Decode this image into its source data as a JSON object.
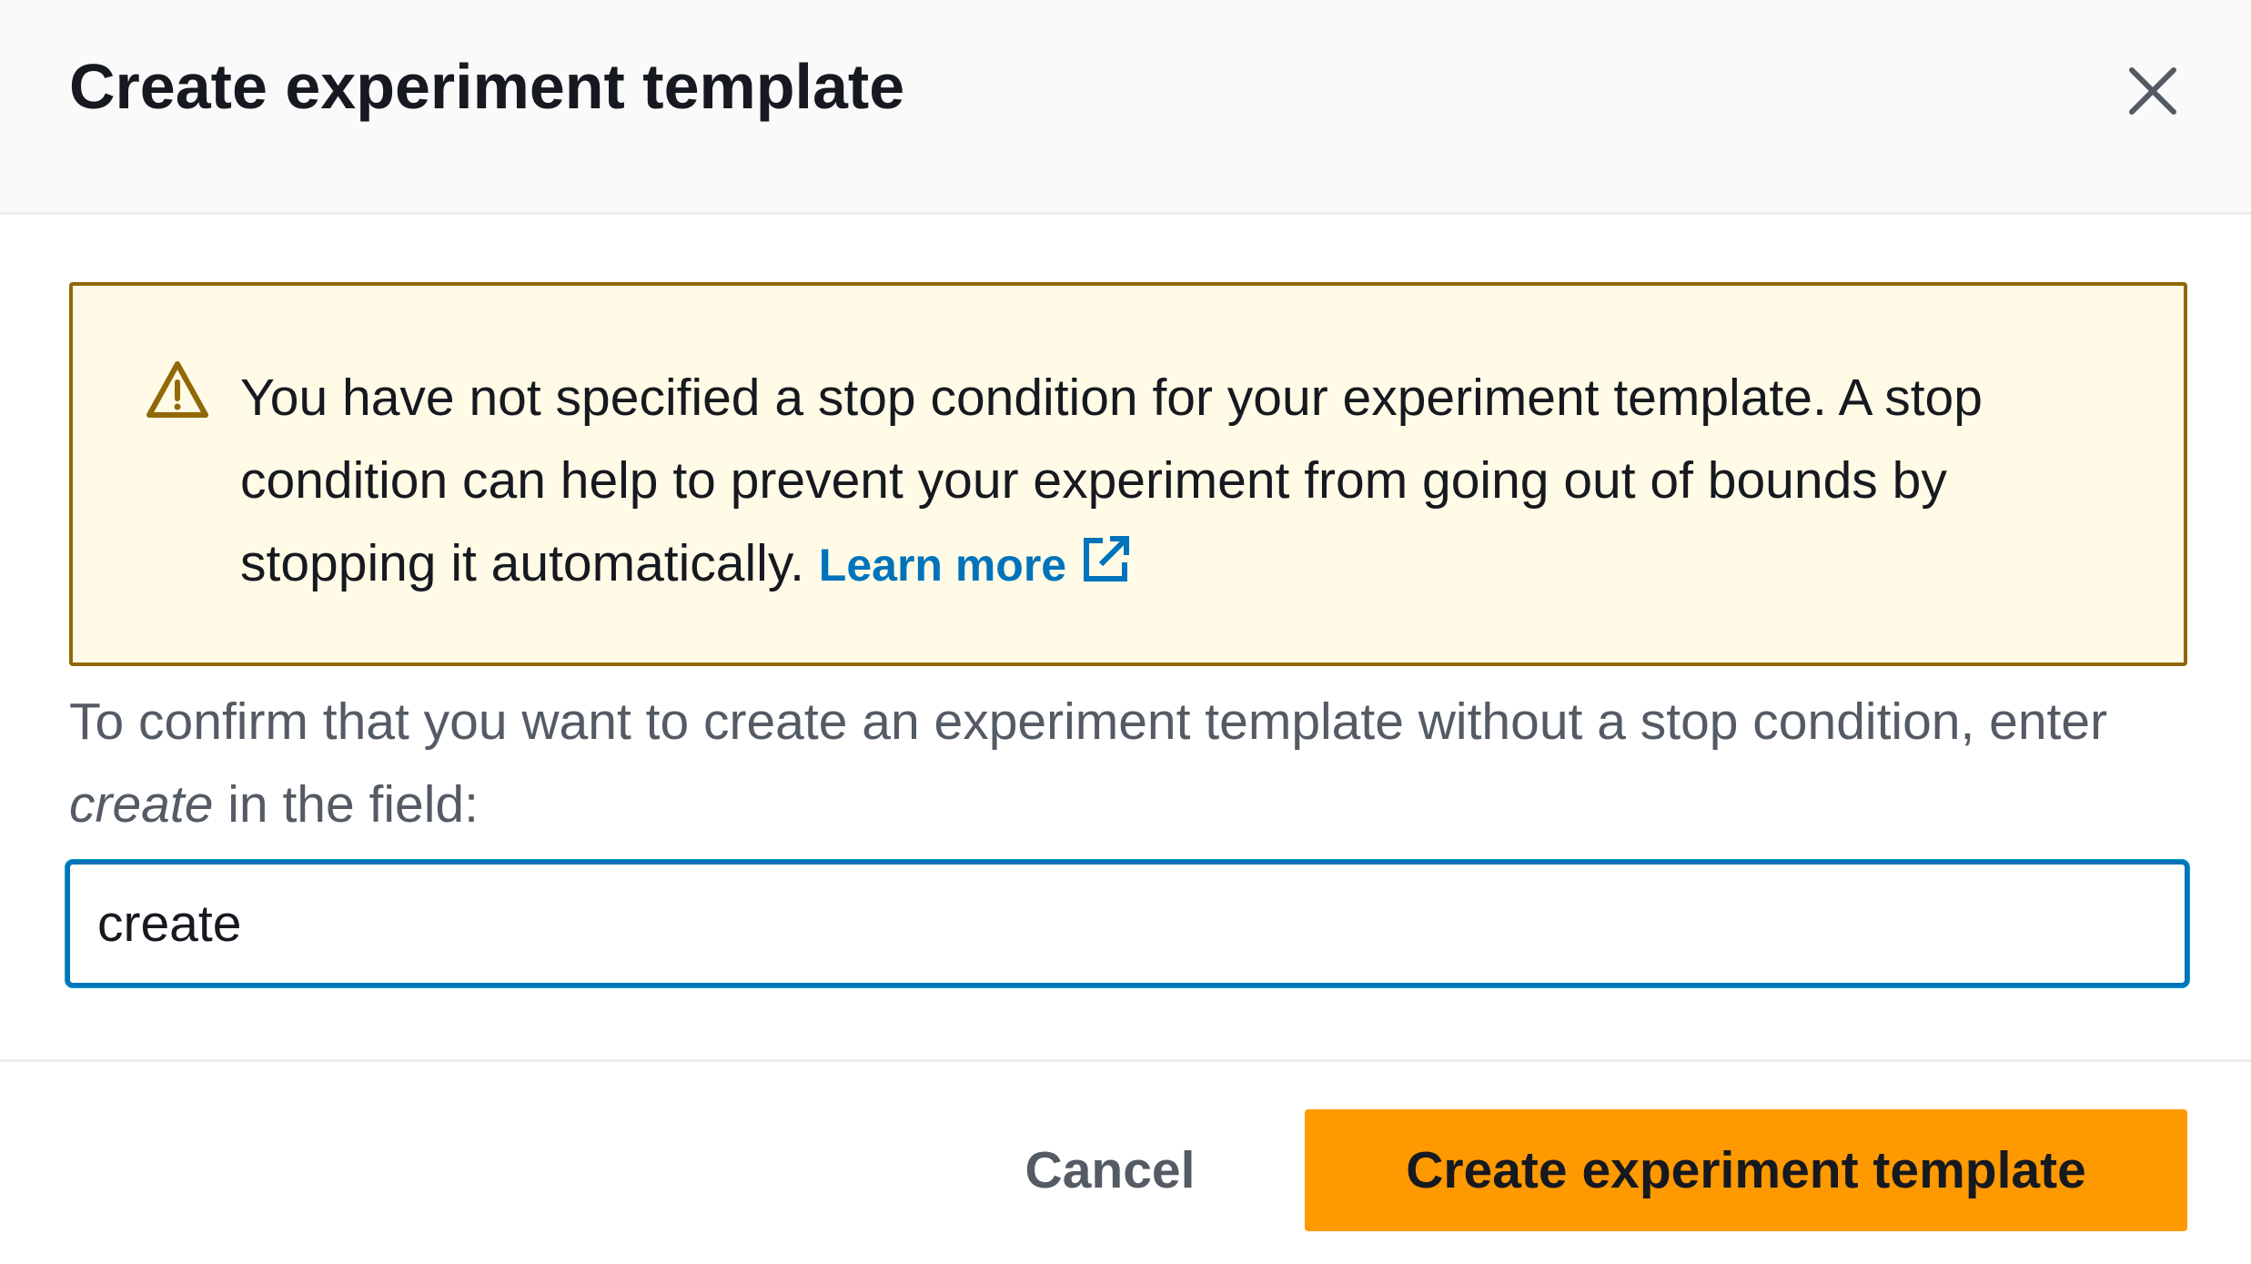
{
  "modal": {
    "title": "Create experiment template",
    "close_icon": "close-icon"
  },
  "alert": {
    "type": "warning",
    "icon": "warning-icon",
    "message": "You have not specified a stop condition for your experiment template. A stop condition can help to prevent your experiment from going out of bounds by stopping it automatically.",
    "link_label": "Learn more",
    "link_icon": "external-link-icon"
  },
  "confirm": {
    "text_before": "To confirm that you want to create an experiment template without a stop condition, enter",
    "keyword": "create",
    "text_after": "in the field:",
    "input_value": "create"
  },
  "footer": {
    "cancel_label": "Cancel",
    "submit_label": "Create experiment template"
  },
  "colors": {
    "primary_button": "#ff9900",
    "link": "#0073bb",
    "warning_border": "#906806",
    "warning_background": "#fffbe6",
    "focus_border": "#0073bb"
  }
}
